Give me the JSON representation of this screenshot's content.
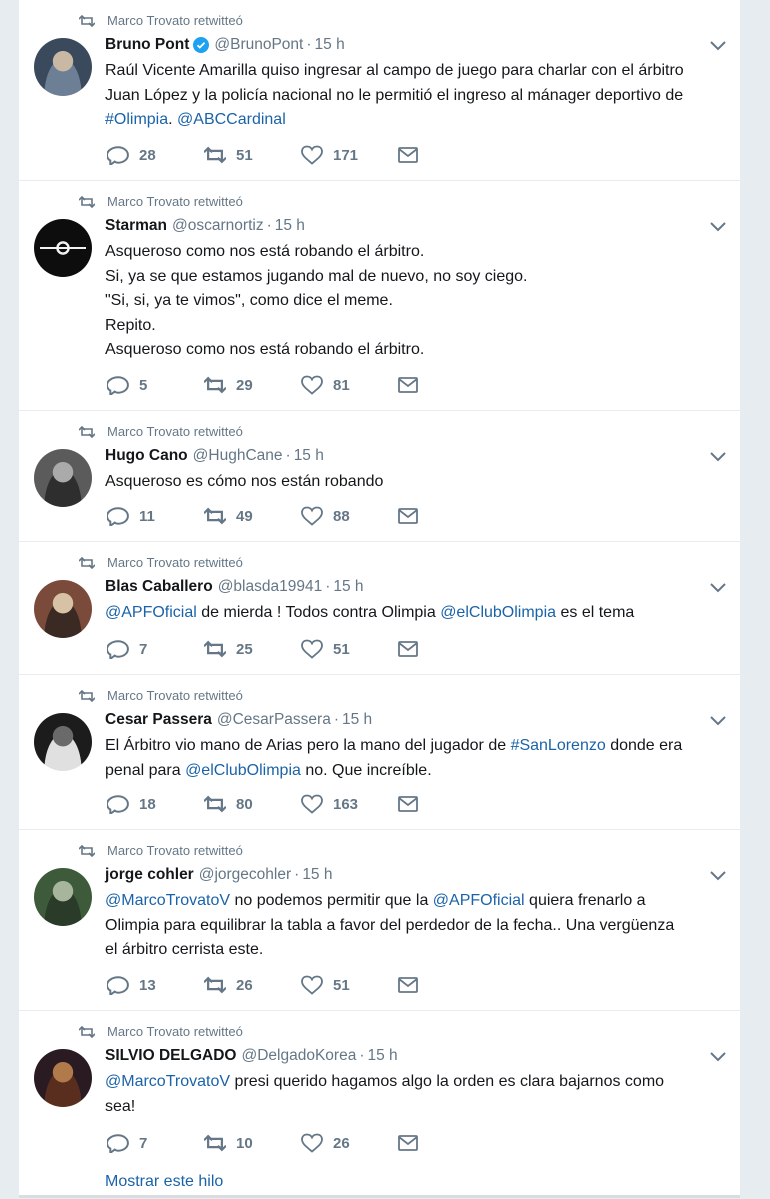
{
  "colors": {
    "accent": "#1b63a9",
    "muted": "#657786",
    "text": "#14171a",
    "verified": "#1da1f2"
  },
  "retweet_context": "Marco Trovato retwitteó",
  "tweets": [
    {
      "fullname": "Bruno Pont",
      "verified": true,
      "handle": "@BrunoPont",
      "time": "15 h",
      "lines": [
        [
          {
            "t": "Raúl Vicente Amarilla quiso ingresar al campo de juego para charlar con el árbitro"
          }
        ],
        [
          {
            "t": "Juan López y la policía nacional no le permitió el ingreso al mánager deportivo de"
          }
        ],
        [
          {
            "t": "#Olimpia",
            "link": true
          },
          {
            "t": ". "
          },
          {
            "t": "@ABCCardinal",
            "link": true
          }
        ]
      ],
      "replies": "28",
      "retweets": "51",
      "likes": "171"
    },
    {
      "fullname": "Starman",
      "verified": false,
      "handle": "@oscarnortiz",
      "time": "15 h",
      "lines": [
        [
          {
            "t": "Asqueroso como nos está robando el árbitro."
          }
        ],
        [
          {
            "t": "Si, ya se que estamos jugando mal de nuevo, no soy ciego."
          }
        ],
        [
          {
            "t": "\"Si, si, ya te vimos\", como dice el meme."
          }
        ],
        [
          {
            "t": "Repito."
          }
        ],
        [
          {
            "t": "Asqueroso como nos está robando el árbitro."
          }
        ]
      ],
      "replies": "5",
      "retweets": "29",
      "likes": "81"
    },
    {
      "fullname": "Hugo Cano",
      "verified": false,
      "handle": "@HughCane",
      "time": "15 h",
      "lines": [
        [
          {
            "t": "Asqueroso es cómo nos están robando"
          }
        ]
      ],
      "replies": "11",
      "retweets": "49",
      "likes": "88"
    },
    {
      "fullname": "Blas Caballero",
      "verified": false,
      "handle": "@blasda19941",
      "time": "15 h",
      "lines": [
        [
          {
            "t": "@APFOficial",
            "link": true
          },
          {
            "t": " de mierda ! Todos contra Olimpia "
          },
          {
            "t": "@elClubOlimpia",
            "link": true
          },
          {
            "t": " es el tema"
          }
        ]
      ],
      "replies": "7",
      "retweets": "25",
      "likes": "51"
    },
    {
      "fullname": "Cesar Passera",
      "verified": false,
      "handle": "@CesarPassera",
      "time": "15 h",
      "lines": [
        [
          {
            "t": "El Árbitro vio mano de Arias pero la mano del jugador de "
          },
          {
            "t": "#SanLorenzo",
            "link": true
          },
          {
            "t": " donde era"
          }
        ],
        [
          {
            "t": "penal para "
          },
          {
            "t": "@elClubOlimpia",
            "link": true
          },
          {
            "t": " no. Que increíble."
          }
        ]
      ],
      "replies": "18",
      "retweets": "80",
      "likes": "163"
    },
    {
      "fullname": "jorge cohler",
      "verified": false,
      "handle": "@jorgecohler",
      "time": "15 h",
      "lines": [
        [
          {
            "t": "@MarcoTrovatoV",
            "link": true
          },
          {
            "t": " no podemos permitir que la "
          },
          {
            "t": "@APFOficial",
            "link": true
          },
          {
            "t": " quiera frenarlo a"
          }
        ],
        [
          {
            "t": "Olimpia para equilibrar la tabla a favor del perdedor de la fecha.. Una vergüenza"
          }
        ],
        [
          {
            "t": "el árbitro cerrista este."
          }
        ]
      ],
      "replies": "13",
      "retweets": "26",
      "likes": "51"
    },
    {
      "fullname": "SILVIO DELGADO",
      "verified": false,
      "handle": "@DelgadoKorea",
      "time": "15 h",
      "lines": [
        [
          {
            "t": "@MarcoTrovatoV",
            "link": true
          },
          {
            "t": " presi querido hagamos algo la orden es clara bajarnos como"
          }
        ],
        [
          {
            "t": "sea!"
          }
        ]
      ],
      "replies": "7",
      "retweets": "10",
      "likes": "26"
    }
  ],
  "show_thread": "Mostrar este hilo"
}
